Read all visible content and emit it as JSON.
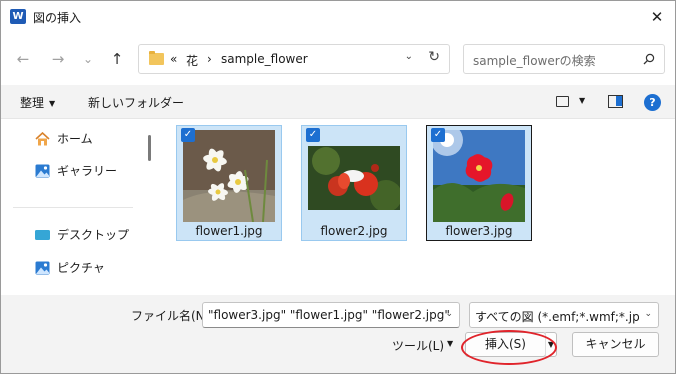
{
  "titlebar": {
    "app_icon": "W",
    "title": "図の挿入",
    "close_icon": "✕"
  },
  "nav": {
    "back_icon": "←",
    "forward_icon": "→",
    "recent_icon": "⌄",
    "up_icon": "↑",
    "breadcrumb": {
      "overflow": "«",
      "folder1": "花",
      "separator": "›",
      "folder2": "sample_flower"
    },
    "dropdown_icon": "⌄",
    "refresh_icon": "↻",
    "search_placeholder": "sample_flowerの検索"
  },
  "toolbar": {
    "organize_label": "整理",
    "new_folder_label": "新しいフォルダー",
    "help_label": "?"
  },
  "sidebar": {
    "items": [
      {
        "label": "ホーム",
        "icon": "home-icon"
      },
      {
        "label": "ギャラリー",
        "icon": "gallery-icon"
      },
      {
        "label": "デスクトップ",
        "icon": "desktop-icon",
        "pinned": true
      },
      {
        "label": "ピクチャ",
        "icon": "pictures-icon",
        "pinned": true
      }
    ],
    "pin_icon": "📌"
  },
  "files": [
    {
      "name": "flower1.jpg",
      "selected": true,
      "focused": false
    },
    {
      "name": "flower2.jpg",
      "selected": true,
      "focused": false
    },
    {
      "name": "flower3.jpg",
      "selected": true,
      "focused": true
    }
  ],
  "footer": {
    "filename_label": "ファイル名(N):",
    "filename_value": "\"flower3.jpg\" \"flower1.jpg\" \"flower2.jpg\"",
    "filter_value": "すべての図 (*.emf;*.wmf;*.jpg;*.jp",
    "tools_label": "ツール(L)",
    "insert_label": "挿入(S)",
    "cancel_label": "キャンセル"
  },
  "colors": {
    "selection": "#cce4f7",
    "accent": "#1d6fd1",
    "annotation": "#e0242b"
  }
}
